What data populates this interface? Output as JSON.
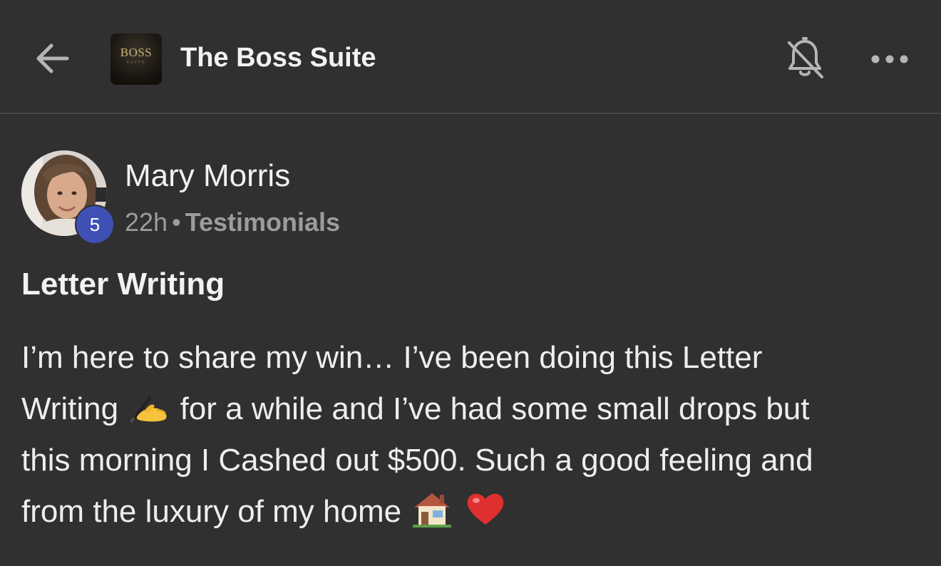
{
  "header": {
    "group_name": "The Boss Suite",
    "group_logo_text": "BOSS",
    "group_logo_subtext": "SUITE",
    "icons": {
      "back": "arrow-left-icon",
      "notifications": "bell-off-icon",
      "more": "more-horizontal-icon"
    }
  },
  "post": {
    "author": {
      "name": "Mary Morris",
      "level": "5"
    },
    "time": "22h",
    "separator": "•",
    "category": "Testimonials",
    "title": "Letter Writing",
    "body": {
      "line1": "I’m here to share my win… I’ve been doing this Letter",
      "line2_a": "Writing",
      "line2_b": "for a while and I’ve had some small drops but",
      "line3": "this morning I Cashed out $500. Such a good feeling and",
      "line4": "from the luxury of my home"
    },
    "emojis": [
      "writing-hand-icon",
      "house-icon",
      "red-heart-icon"
    ]
  },
  "colors": {
    "background": "#303030",
    "divider": "#474747",
    "text": "#f2f2f2",
    "muted": "#9c9c9c",
    "badge": "#3f51b5"
  }
}
